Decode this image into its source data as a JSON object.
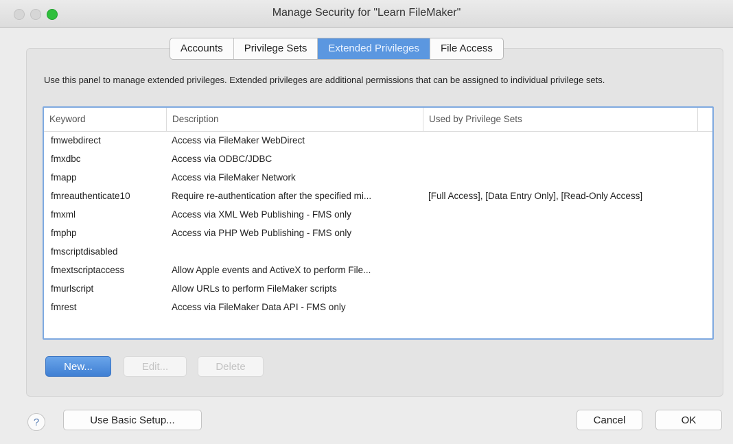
{
  "window": {
    "title": "Manage Security for \"Learn FileMaker\""
  },
  "tabs": [
    {
      "label": "Accounts"
    },
    {
      "label": "Privilege Sets"
    },
    {
      "label": "Extended Privileges"
    },
    {
      "label": "File Access"
    }
  ],
  "description": "Use this panel to manage extended privileges. Extended privileges are additional permissions that can be assigned to individual privilege sets.",
  "table": {
    "headers": [
      "Keyword",
      "Description",
      "Used by Privilege Sets"
    ],
    "rows": [
      {
        "keyword": "fmwebdirect",
        "description": "Access via FileMaker WebDirect",
        "used_by": ""
      },
      {
        "keyword": "fmxdbc",
        "description": "Access via ODBC/JDBC",
        "used_by": ""
      },
      {
        "keyword": "fmapp",
        "description": "Access via FileMaker Network",
        "used_by": ""
      },
      {
        "keyword": "fmreauthenticate10",
        "description": "Require re-authentication after the specified mi...",
        "used_by": "[Full Access], [Data Entry Only], [Read-Only Access]"
      },
      {
        "keyword": "fmxml",
        "description": "Access via XML Web Publishing - FMS only",
        "used_by": ""
      },
      {
        "keyword": "fmphp",
        "description": "Access via PHP Web Publishing - FMS only",
        "used_by": ""
      },
      {
        "keyword": "fmscriptdisabled",
        "description": "",
        "used_by": ""
      },
      {
        "keyword": "fmextscriptaccess",
        "description": "Allow Apple events and ActiveX to perform File...",
        "used_by": ""
      },
      {
        "keyword": "fmurlscript",
        "description": "Allow URLs to perform FileMaker scripts",
        "used_by": ""
      },
      {
        "keyword": "fmrest",
        "description": "Access via FileMaker Data API - FMS only",
        "used_by": ""
      }
    ]
  },
  "buttons": {
    "new": "New...",
    "edit": "Edit...",
    "delete": "Delete",
    "basic_setup": "Use Basic Setup...",
    "cancel": "Cancel",
    "ok": "OK",
    "help": "?"
  }
}
